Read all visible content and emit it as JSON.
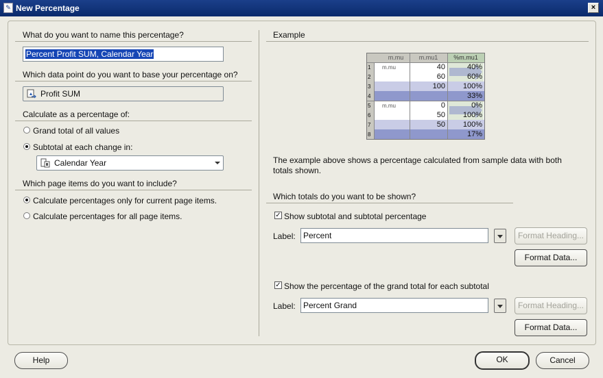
{
  "window": {
    "title": "New Percentage",
    "close_label": "×"
  },
  "left": {
    "name_question": "What do you want to name this percentage?",
    "name_value": "Percent Profit SUM, Calendar Year",
    "datapoint_question": "Which data point do you want to base your percentage on?",
    "datapoint_value": "Profit SUM",
    "calc_label": "Calculate as a percentage of:",
    "radio_grand": "Grand total of all values",
    "radio_subtotal": "Subtotal at each change in:",
    "subtotal_combo": "Calendar Year",
    "page_items_question": "Which page items do you want to include?",
    "radio_current": "Calculate percentages only for current page items.",
    "radio_all": "Calculate percentages for all page items."
  },
  "right": {
    "example_label": "Example",
    "table": {
      "headers": [
        "m.mu",
        "m.mu1",
        "%m.mu1"
      ],
      "rows": [
        {
          "n": "1",
          "a": "m.mu",
          "b": "40",
          "c": "40%"
        },
        {
          "n": "2",
          "a": "",
          "b": "60",
          "c": "60%"
        },
        {
          "n": "3",
          "a": "",
          "b": "100",
          "c": "100%"
        },
        {
          "n": "4",
          "a": "",
          "b": "",
          "c": "33%"
        },
        {
          "n": "5",
          "a": "m.mu",
          "b": "0",
          "c": "0%"
        },
        {
          "n": "6",
          "a": "",
          "b": "50",
          "c": "100%"
        },
        {
          "n": "7",
          "a": "",
          "b": "50",
          "c": "100%"
        },
        {
          "n": "8",
          "a": "",
          "b": "",
          "c": "17%"
        }
      ]
    },
    "example_desc": "The example above shows a percentage calculated from sample data with both totals shown.",
    "totals_question": "Which totals do you want to be shown?",
    "chk_subtotal": "Show subtotal and subtotal percentage",
    "label1_caption": "Label:",
    "label1_value": "Percent",
    "format_heading1": "Format Heading...",
    "format_data1": "Format Data...",
    "chk_grand": "Show the percentage of the grand total for each subtotal",
    "label2_caption": "Label:",
    "label2_value": "Percent Grand",
    "format_heading2": "Format Heading...",
    "format_data2": "Format Data..."
  },
  "footer": {
    "help": "Help",
    "ok": "OK",
    "cancel": "Cancel"
  },
  "colors": {
    "titlebar": "#0a2a6b",
    "selection": "#1646b5",
    "table_band": "#aeb3d8",
    "table_highlight": "#dfe8d8"
  }
}
